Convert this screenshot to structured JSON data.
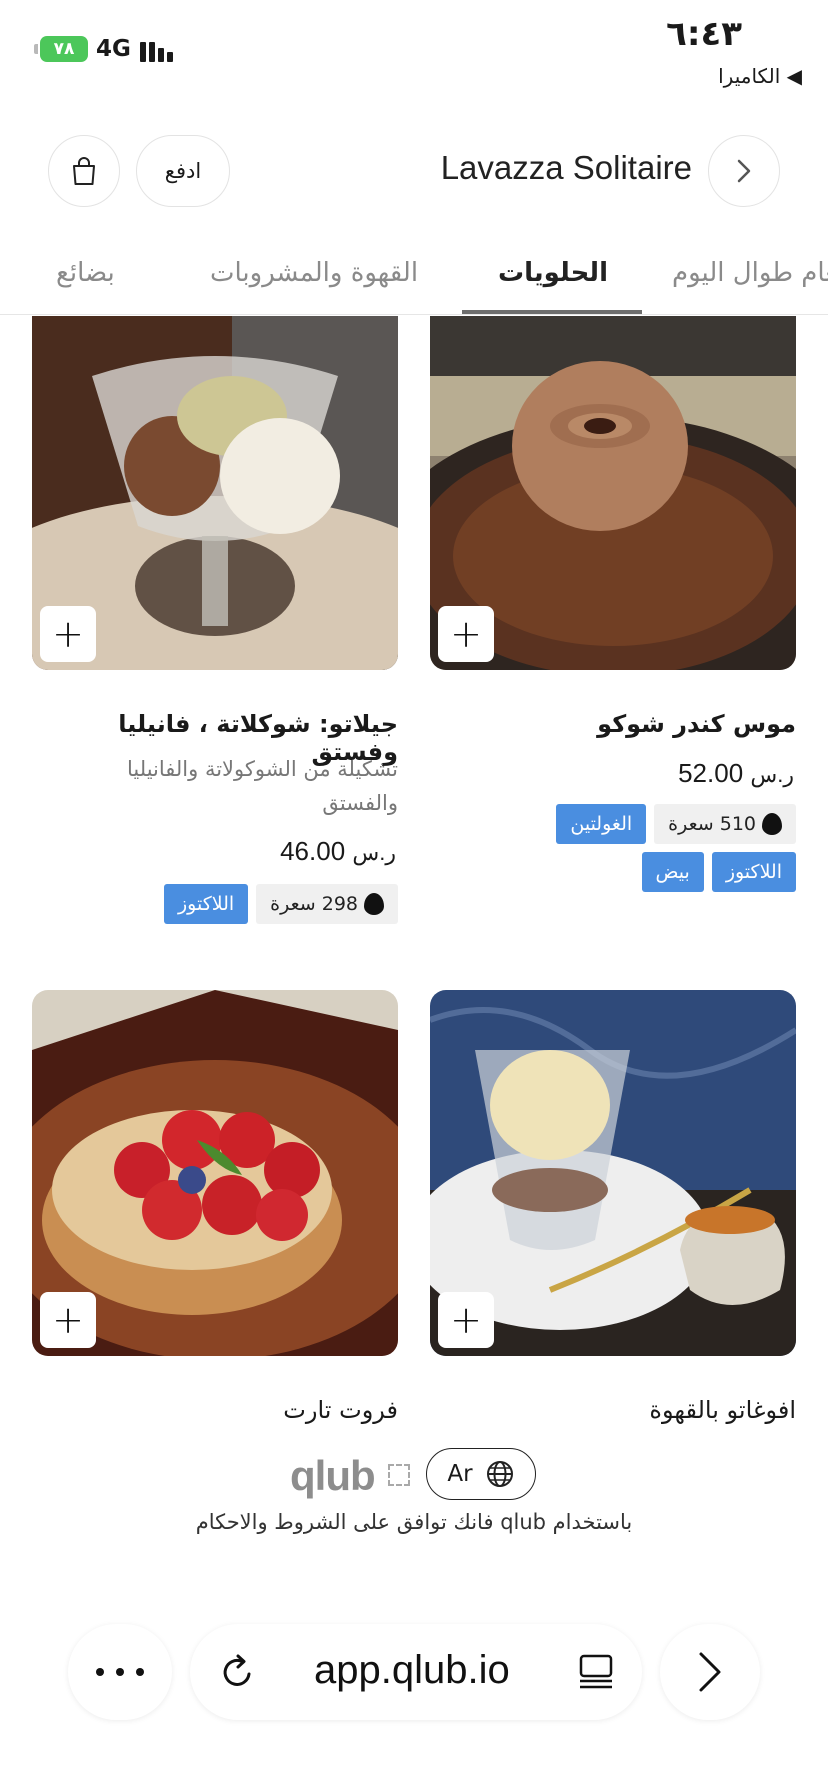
{
  "status_bar": {
    "battery": "٧٨",
    "network": "4G",
    "time": "٦:٤٣",
    "back_label": "◀ الكاميرا"
  },
  "header": {
    "title": "Lavazza Solitaire",
    "pay_label": "ادفع",
    "bag_icon": "shopping-bag-icon",
    "nav_icon": "chevron-right-icon"
  },
  "tabs": [
    {
      "label": "بضائع"
    },
    {
      "label": "القهوة والمشروبات"
    },
    {
      "label": "الحلويات",
      "active": true
    },
    {
      "label": "طعام طوال اليوم"
    }
  ],
  "items": [
    {
      "name": "موس كندر شوكو",
      "price": "52.00",
      "currency": "ر.س",
      "calories": "510 سعرة",
      "tags_row1": [
        "الغولتين"
      ],
      "tags_row2": [
        "اللاكتوز",
        "بيض"
      ]
    },
    {
      "name": "جيلاتو: شوكلاتة ، فانيليا وفستق",
      "description": "تشكيلة من الشوكولاتة والفانيليا والفستق",
      "price": "46.00",
      "currency": "ر.س",
      "calories": "298 سعرة",
      "tags_row1": [
        "اللاكتوز"
      ]
    },
    {
      "name": "افوغاتو بالقهوة"
    },
    {
      "name": "فروت تارت"
    }
  ],
  "footer": {
    "brand": "qlub",
    "language": "Ar",
    "terms": "باستخدام qlub فانك توافق على  الشروط والاحكام"
  },
  "browser": {
    "url": "app.qlub.io",
    "more_icon": "ellipsis-icon",
    "reload_icon": "reload-icon",
    "reader_icon": "reader-icon",
    "forward_icon": "chevron-right-icon"
  }
}
